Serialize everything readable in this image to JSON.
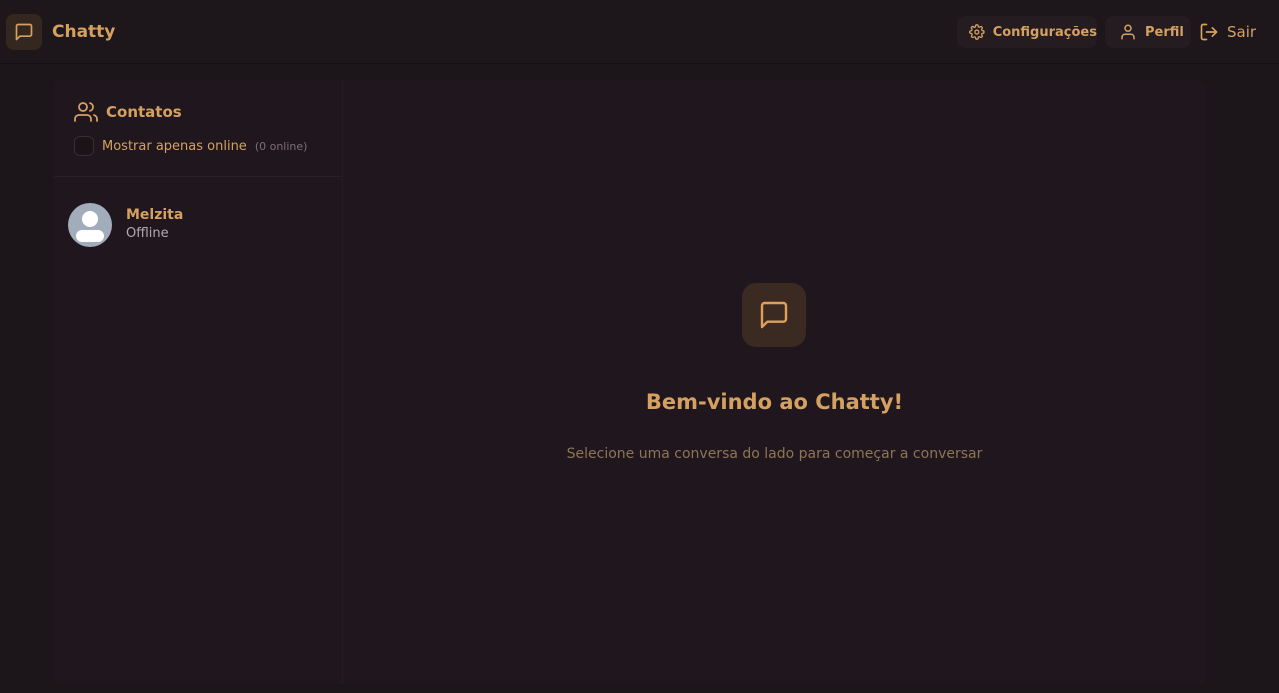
{
  "header": {
    "app_name": "Chatty",
    "settings_label": "Configurações",
    "profile_label": "Perfil",
    "logout_label": "Sair",
    "icons": {
      "brand": "message-square-icon",
      "settings": "gear-icon",
      "profile": "user-icon",
      "logout": "log-out-icon"
    }
  },
  "sidebar": {
    "title": "Contatos",
    "title_icon": "users-icon",
    "filter_label": "Mostrar apenas online",
    "online_count": "(0 online)",
    "filter_checked": false,
    "contacts": [
      {
        "name": "Melzita",
        "status": "Offline"
      }
    ]
  },
  "main": {
    "welcome_icon": "message-square-icon",
    "welcome_title": "Bem-vindo ao Chatty!",
    "welcome_subtitle": "Selecione uma conversa do lado para começar a conversar"
  },
  "colors": {
    "accent": "#d6a160",
    "background": "#1c1519",
    "panel": "#1f161e"
  }
}
